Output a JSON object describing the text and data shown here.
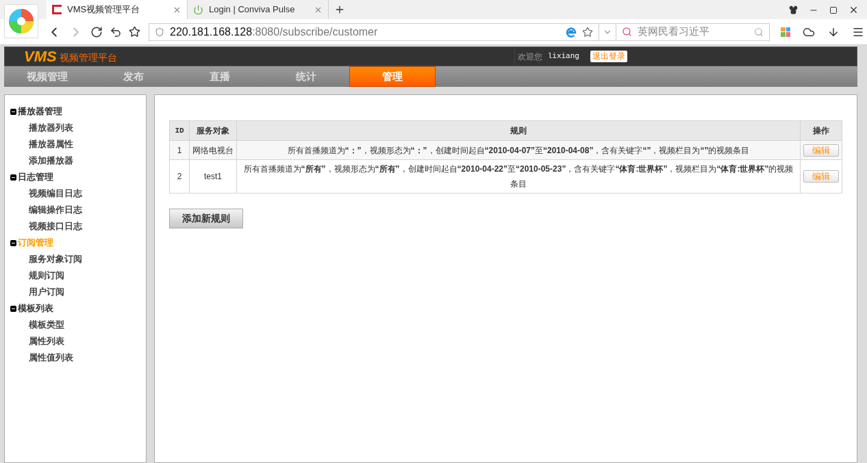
{
  "browser": {
    "tabs": [
      {
        "title": "VMS视频管理平台",
        "selected": true,
        "kind": "vms"
      },
      {
        "title": "Login | Conviva Pulse",
        "selected": false,
        "kind": "power"
      }
    ],
    "address": {
      "host": "220.181.168.128",
      "rest": ":8080/subscribe/customer"
    },
    "search": {
      "placeholder": "英网民看习近平"
    }
  },
  "header": {
    "logo": "VMS",
    "subtitle": "视频管理平台",
    "welcome": "欢迎您",
    "user": "lixiang",
    "logout": "退出登录"
  },
  "nav": [
    {
      "label": "视频管理",
      "selected": false
    },
    {
      "label": "发布",
      "selected": false
    },
    {
      "label": "直播",
      "selected": false
    },
    {
      "label": "统计",
      "selected": false
    },
    {
      "label": "管理",
      "selected": true
    }
  ],
  "sidebar": [
    {
      "label": "播放器管理",
      "selected": false,
      "children": [
        {
          "label": "播放器列表"
        },
        {
          "label": "播放器属性"
        },
        {
          "label": "添加播放器"
        }
      ]
    },
    {
      "label": "日志管理",
      "selected": false,
      "children": [
        {
          "label": "视频编目日志"
        },
        {
          "label": "编辑操作日志"
        },
        {
          "label": "视频接口日志"
        }
      ]
    },
    {
      "label": "订阅管理",
      "selected": true,
      "children": [
        {
          "label": "服务对象订阅"
        },
        {
          "label": "规则订阅"
        },
        {
          "label": "用户订阅"
        }
      ]
    },
    {
      "label": "模板列表",
      "selected": false,
      "children": [
        {
          "label": "模板类型"
        },
        {
          "label": "属性列表"
        },
        {
          "label": "属性值列表"
        }
      ]
    }
  ],
  "table": {
    "columns": [
      "ID",
      "服务对象",
      "规则",
      "操作"
    ],
    "rows": [
      {
        "id": "1",
        "target": "网络电视台",
        "rule": "所有首播频道为**“：”**，视频形态为**“：”**，创建时间起自**“2010-04-07”**至**“2010-04-08”**，含有关键字**“”**，视频栏目为**“”**的视频条目",
        "action": "编辑"
      },
      {
        "id": "2",
        "target": "test1",
        "rule": "所有首播频道为**“所有”**，视频形态为**“所有”**，创建时间起自**“2010-04-22”**至**“2010-05-23”**，含有关键字**“体育:世界杯”**，视频栏目为**“体育:世界杯”**的视频条目",
        "action": "编辑"
      }
    ]
  },
  "add_button": "添加新规则"
}
